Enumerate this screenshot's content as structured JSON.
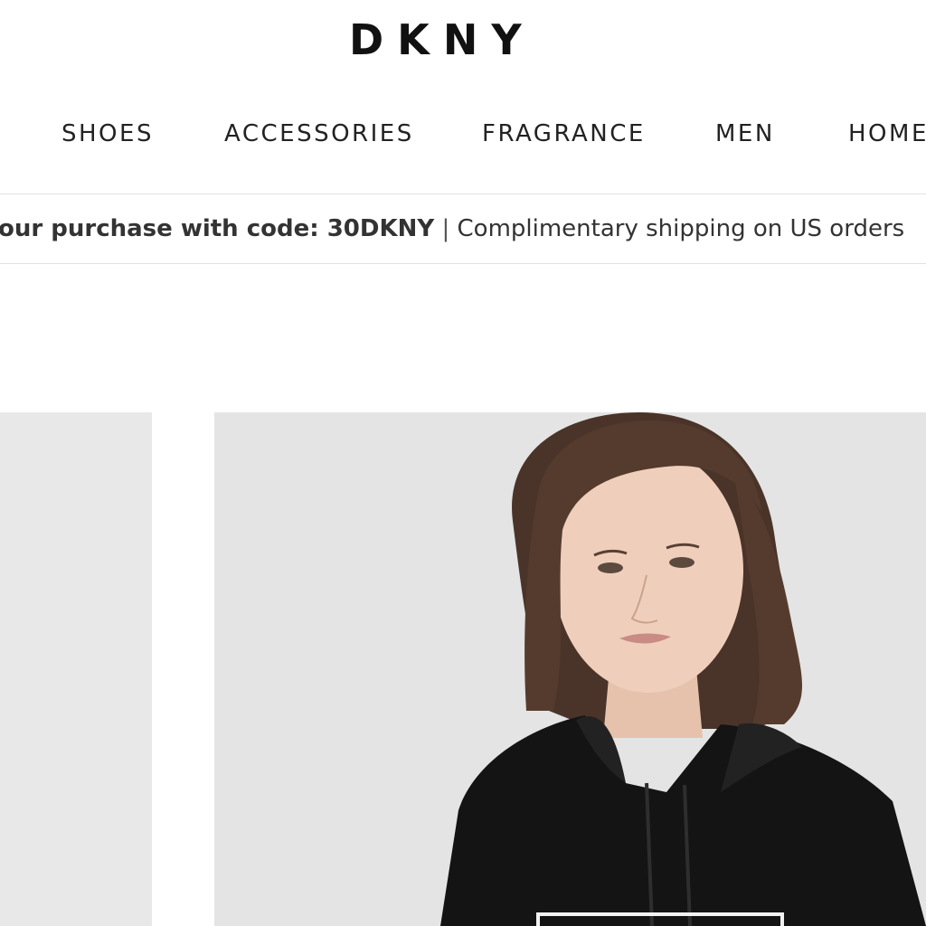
{
  "brand": {
    "logo_text": "DKNY"
  },
  "nav": {
    "items": [
      {
        "label": "SHOES"
      },
      {
        "label": "ACCESSORIES"
      },
      {
        "label": "FRAGRANCE"
      },
      {
        "label": "MEN"
      },
      {
        "label": "HOME"
      }
    ]
  },
  "promo": {
    "bold_text": "our purchase with code: 30DKNY",
    "separator": "|",
    "regular_text": "Complimentary shipping on US orders"
  },
  "hero": {
    "image_name": "model-black-hoodie-photo",
    "background_color": "#e4e4e4"
  },
  "colors": {
    "text": "#222222",
    "border": "#e2e2e2",
    "placeholder_panel": "#e8e8e8"
  }
}
